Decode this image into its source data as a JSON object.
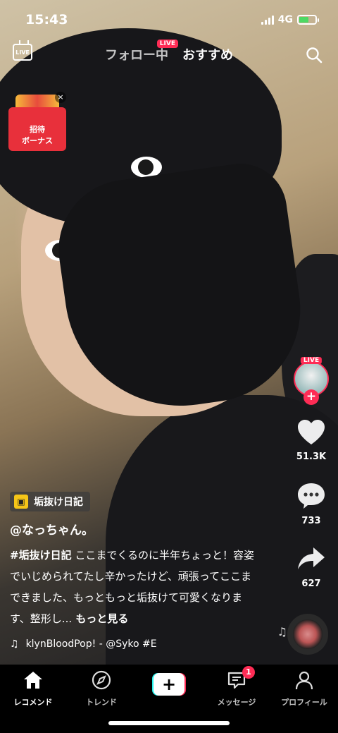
{
  "status_bar": {
    "time": "15:43",
    "network": "4G"
  },
  "top_nav": {
    "live_icon_label": "LIVE",
    "tabs": [
      {
        "label": "フォロー中",
        "badge": "LIVE"
      },
      {
        "label": "おすすめ"
      }
    ]
  },
  "bonus": {
    "line1": "招待",
    "line2": "ボーナス"
  },
  "right_rail": {
    "avatar_live": "LIVE",
    "likes": "51.3K",
    "comments": "733",
    "shares": "627"
  },
  "post": {
    "hashtag_chip": "垢抜け日記",
    "username": "@なっちゃん。",
    "caption_tag": "#垢抜け日記",
    "caption_text": " ここまでくるのに半年ちょっと！容姿でいじめられてたし辛かったけど、頑張ってここまできました、もっともっと垢抜けて可愛くなります、整形し...",
    "more": " もっと見る",
    "music": "klynBloodPop! - @Syko    #E"
  },
  "bottom_nav": [
    {
      "label": "レコメンド",
      "icon": "home-icon"
    },
    {
      "label": "トレンド",
      "icon": "compass-icon"
    },
    {
      "label": "メッセージ",
      "icon": "message-icon",
      "badge": "1"
    },
    {
      "label": "プロフィール",
      "icon": "profile-icon"
    }
  ]
}
